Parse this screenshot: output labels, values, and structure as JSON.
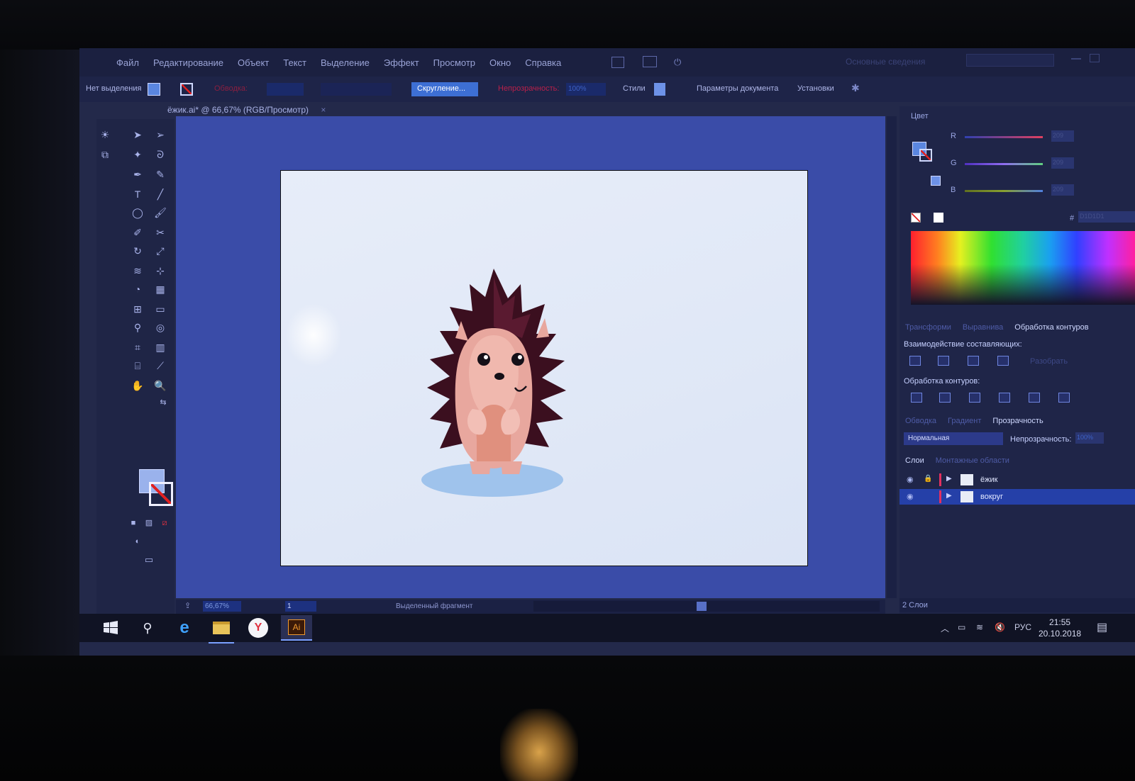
{
  "menubar": {
    "items": [
      "Файл",
      "Редактирование",
      "Объект",
      "Текст",
      "Выделение",
      "Эффект",
      "Просмотр",
      "Окно",
      "Справка"
    ],
    "workspace": "Основные сведения"
  },
  "controlbar": {
    "selection": "Нет выделения",
    "stroke_label": "Обводка:",
    "round_button": "Скругление...",
    "opacity_label": "Непрозрачность:",
    "opacity_value": "100%",
    "styles_label": "Стили",
    "doc_params": "Параметры документа",
    "settings": "Установки"
  },
  "document": {
    "tab_title": "ёжик.ai* @ 66,67% (RGB/Просмотр)",
    "close": "×"
  },
  "statusbar": {
    "zoom": "66,67%",
    "page": "1",
    "info": "Выделенный фрагмент"
  },
  "panels": {
    "color": {
      "title": "Цвет",
      "channels": [
        {
          "label": "R",
          "value": "209",
          "color": "#e04060"
        },
        {
          "label": "G",
          "value": "209",
          "color": "#8f6cf0"
        },
        {
          "label": "B",
          "value": "209",
          "color": "#88a030"
        }
      ],
      "hex_label": "#",
      "hex_value": "D1D1D1"
    },
    "tabs1": [
      "Трансформи",
      "Выравнива",
      "Обработка контуров"
    ],
    "pathfinder": {
      "shape_modes": "Взаимодействие составляющих:",
      "expand": "Разобрать",
      "pathfinders": "Обработка контуров:"
    },
    "tabs2": [
      "Обводка",
      "Градиент",
      "Прозрачность"
    ],
    "transparency": {
      "blend_mode": "Нормальная",
      "opacity_label": "Непрозрачность:",
      "opacity_value": "100%"
    },
    "tabs3": [
      "Слои",
      "Монтажные области"
    ],
    "layers": [
      {
        "name": "ёжик",
        "locked": true
      },
      {
        "name": "вокруг",
        "locked": false
      }
    ],
    "layers_count": "2 Слои"
  },
  "taskbar": {
    "language": "РУС",
    "time": "21:55",
    "date": "20.10.2018",
    "ai_label": "Ai"
  },
  "colors": {
    "accent": "#3d6fd4",
    "artboard": "#e3eaf8",
    "quill": "#3b0f1f",
    "skin": "#e8a79e"
  }
}
